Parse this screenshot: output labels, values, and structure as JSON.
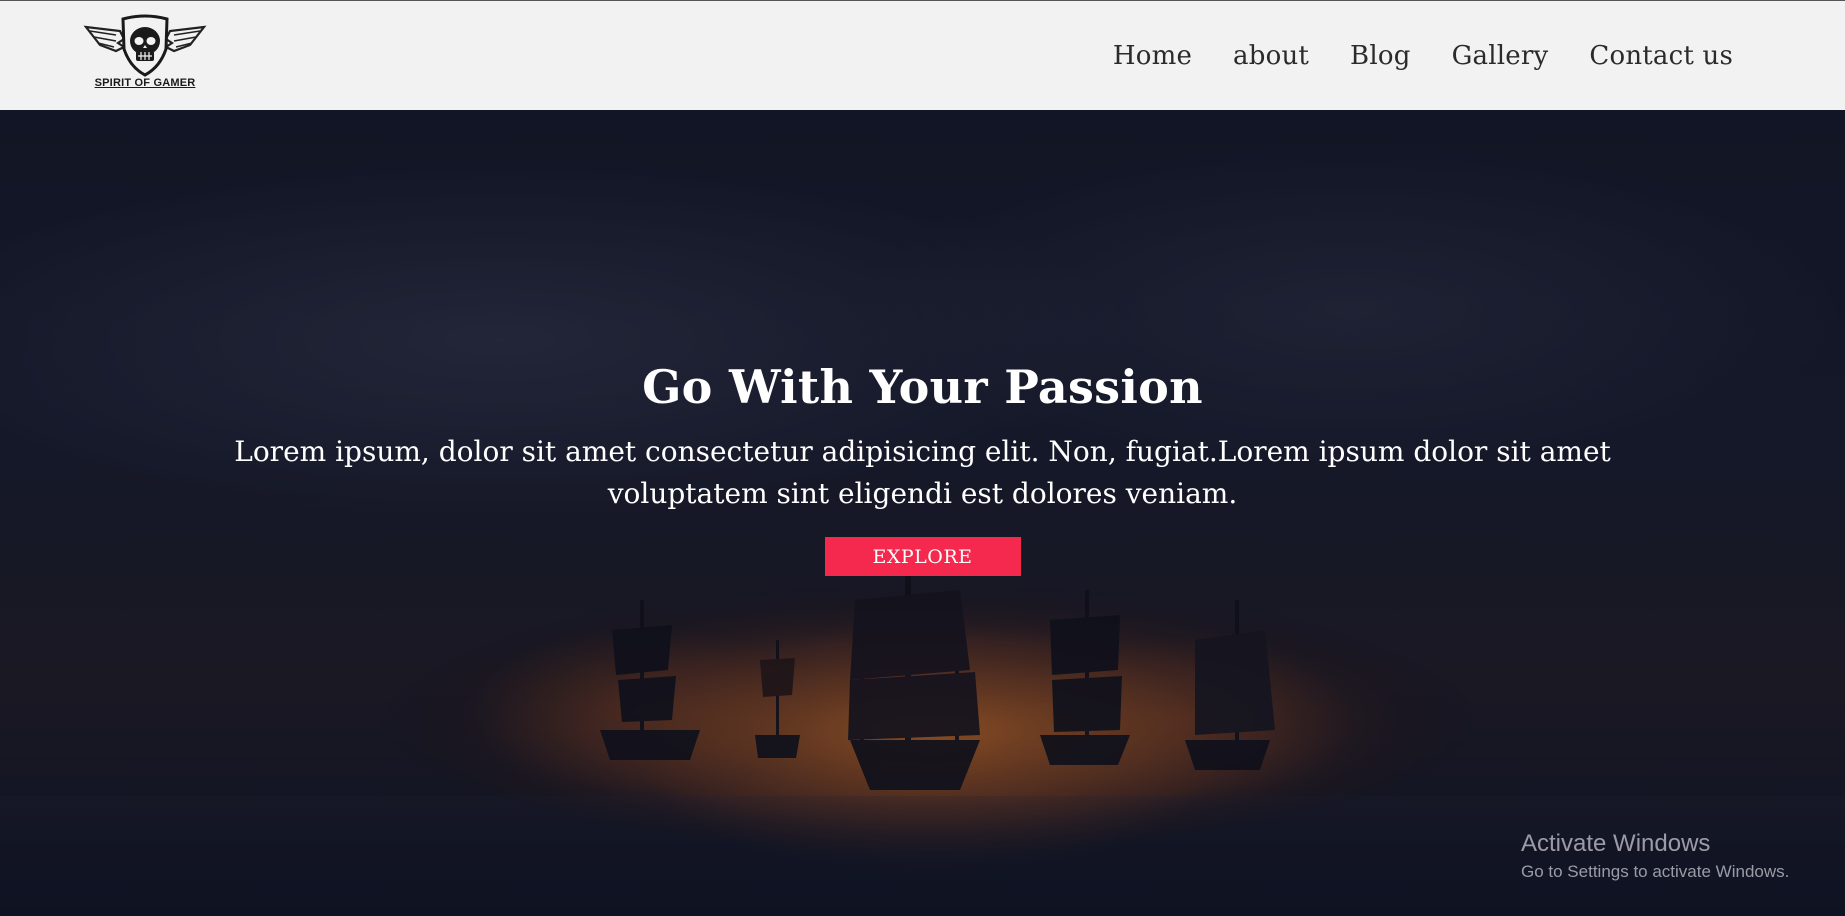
{
  "header": {
    "logo_text": "SPIRIT OF GAMER",
    "nav": [
      {
        "label": "Home"
      },
      {
        "label": "about"
      },
      {
        "label": "Blog"
      },
      {
        "label": "Gallery"
      },
      {
        "label": "Contact us"
      }
    ]
  },
  "hero": {
    "title": "Go With Your Passion",
    "text": "Lorem ipsum, dolor sit amet consectetur adipisicing elit. Non, fugiat.Lorem ipsum dolor sit amet voluptatem sint eligendi est dolores veniam.",
    "button_label": "EXPLORE",
    "background_scene": "pirate-ships-battle"
  },
  "watermark": {
    "title": "Activate Windows",
    "subtitle": "Go to Settings to activate Windows."
  },
  "colors": {
    "header_bg": "#f2f2f2",
    "accent": "#f5294d",
    "hero_text": "#ffffff",
    "nav_text": "#2b2b2b"
  }
}
